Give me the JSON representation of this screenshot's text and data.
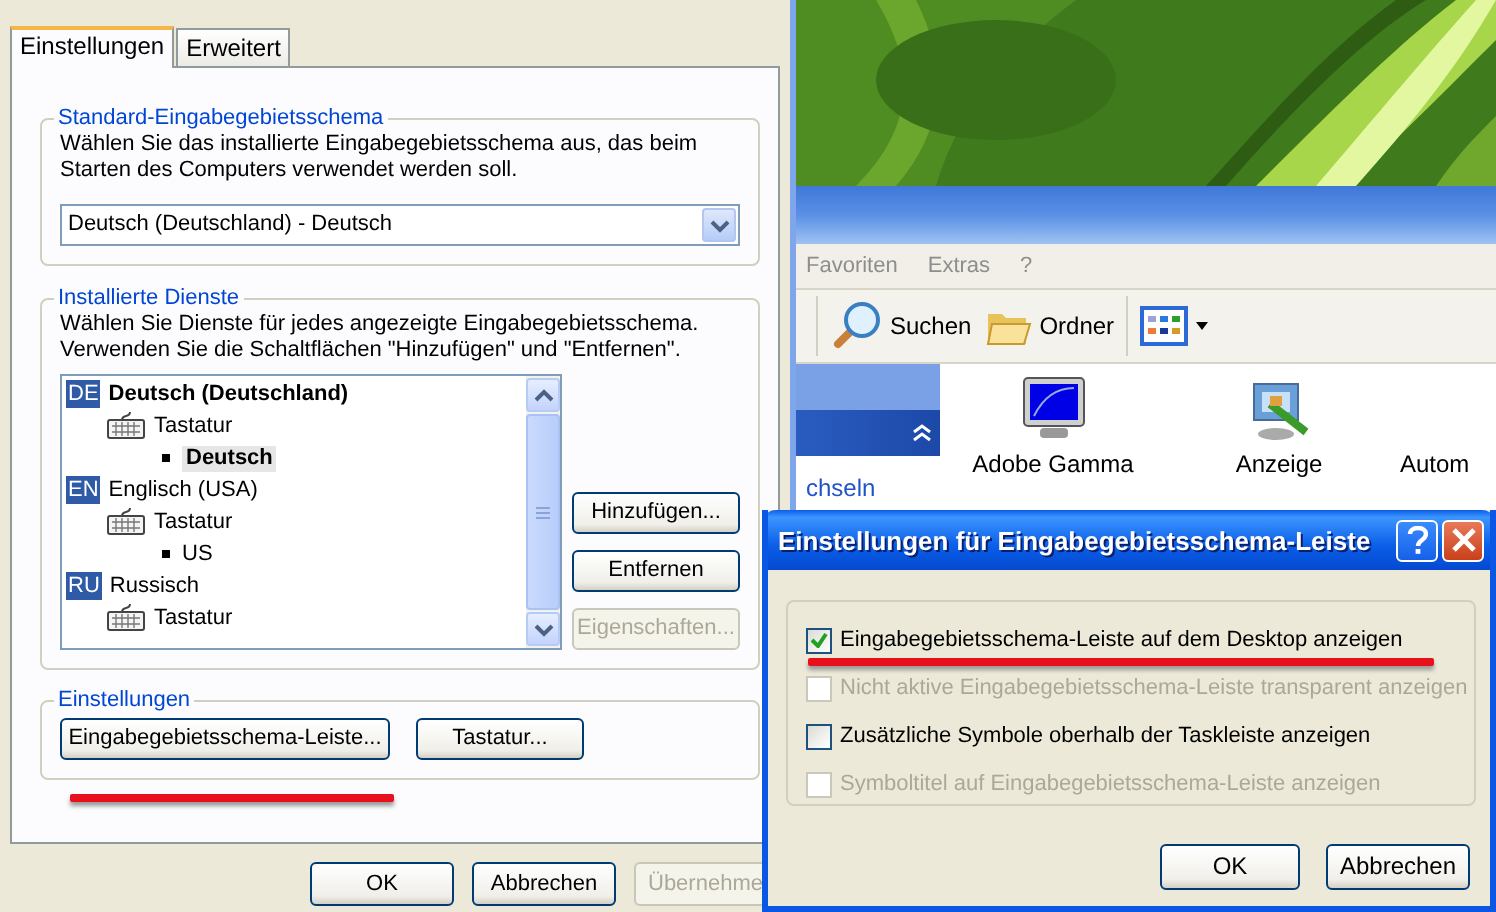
{
  "main_dialog": {
    "tabs": [
      {
        "label": "Einstellungen",
        "selected": true
      },
      {
        "label": "Erweitert",
        "selected": false
      }
    ],
    "default_group": {
      "legend": "Standard-Eingabegebietsschema",
      "description": "Wählen Sie das installierte Eingabegebietsschema aus, das beim Starten des Computers verwendet werden soll.",
      "dropdown": {
        "value": "Deutsch (Deutschland) - Deutsch"
      }
    },
    "services_group": {
      "legend": "Installierte Dienste",
      "description": "Wählen Sie Dienste für jedes angezeigte Eingabegebietsschema. Verwenden Sie die Schaltflächen \"Hinzufügen\" und \"Entfernen\".",
      "tree": [
        {
          "badge": "DE",
          "label": "Deutsch (Deutschland)",
          "default": true,
          "children": [
            {
              "label": "Tastatur",
              "children": [
                {
                  "label": "Deutsch",
                  "selected": true
                }
              ]
            }
          ]
        },
        {
          "badge": "EN",
          "label": "Englisch (USA)",
          "default": false,
          "children": [
            {
              "label": "Tastatur",
              "children": [
                {
                  "label": "US",
                  "selected": false
                }
              ]
            }
          ]
        },
        {
          "badge": "RU",
          "label": "Russisch",
          "default": false,
          "children": [
            {
              "label": "Tastatur"
            }
          ]
        }
      ],
      "buttons": [
        {
          "label": "Hinzufügen...",
          "disabled": false
        },
        {
          "label": "Entfernen",
          "disabled": false
        },
        {
          "label": "Eigenschaften...",
          "disabled": true
        }
      ]
    },
    "settings_group": {
      "legend": "Einstellungen",
      "buttons": [
        {
          "label": "Eingabegebietsschema-Leiste...",
          "disabled": false
        },
        {
          "label": "Tastatur...",
          "disabled": false
        }
      ]
    },
    "footer_buttons": [
      {
        "label": "OK",
        "disabled": false
      },
      {
        "label": "Abbrechen",
        "disabled": false
      },
      {
        "label": "Übernehme",
        "disabled": true
      }
    ]
  },
  "explorer": {
    "menu": [
      "Favoriten",
      "Extras",
      "?"
    ],
    "toolbar": [
      {
        "kind": "search",
        "label": "Suchen"
      },
      {
        "kind": "folder",
        "label": "Ordner"
      },
      {
        "kind": "views"
      }
    ],
    "side_link": "chseln",
    "items": [
      {
        "kind": "monitor",
        "label": "Adobe Gamma"
      },
      {
        "kind": "display",
        "label": "Anzeige"
      },
      {
        "kind": "none",
        "label": "Autom"
      }
    ]
  },
  "bar_dialog": {
    "title": "Einstellungen für Eingabegebietsschema-Leiste",
    "options": [
      {
        "label": "Eingabegebietsschema-Leiste auf dem Desktop anzeigen",
        "checked": true,
        "disabled": false
      },
      {
        "label": "Nicht aktive Eingabegebietsschema-Leiste transparent anzeigen",
        "checked": false,
        "disabled": true
      },
      {
        "label": "Zusätzliche Symbole oberhalb der Taskleiste anzeigen",
        "checked": false,
        "disabled": false
      },
      {
        "label": "Symboltitel auf Eingabegebietsschema-Leiste anzeigen",
        "checked": false,
        "disabled": true
      }
    ],
    "buttons": [
      {
        "label": "OK"
      },
      {
        "label": "Abbrechen"
      }
    ]
  }
}
